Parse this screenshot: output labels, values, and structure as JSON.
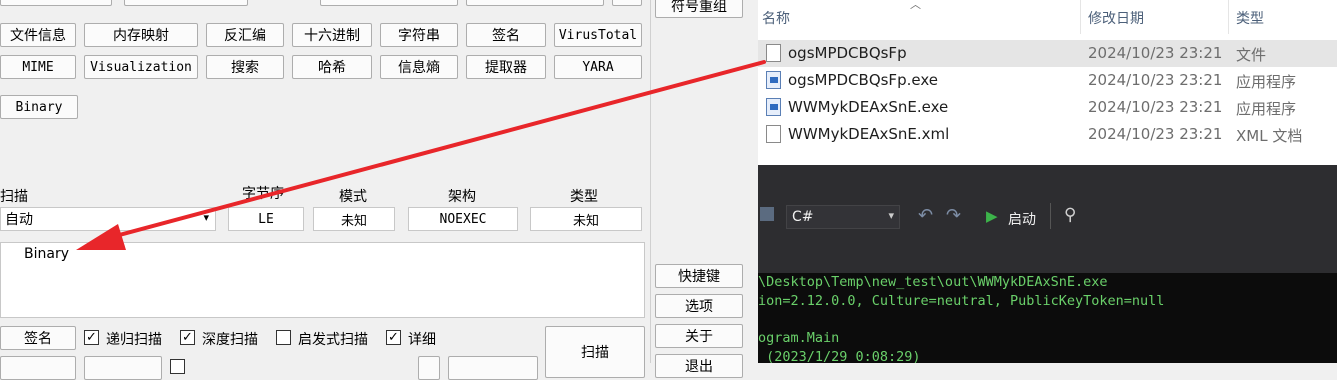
{
  "tool_panel": {
    "top_buttons": [
      "文件信息",
      "内存映射",
      "反汇编",
      "十六进制",
      "字符串",
      "签名",
      "VirusTotal"
    ],
    "second_buttons": [
      "MIME",
      "Visualization",
      "搜索",
      "哈希",
      "信息熵",
      "提取器",
      "YARA"
    ],
    "binary_button": "Binary",
    "right_buttons": [
      "符号重组",
      "快捷键",
      "选项",
      "关于",
      "退出"
    ],
    "scan_label": "扫描",
    "scan_value": "自动",
    "columns": {
      "endian": {
        "label": "字节序",
        "value": "LE"
      },
      "mode": {
        "label": "模式",
        "value": "未知"
      },
      "arch": {
        "label": "架构",
        "value": "NOEXEC"
      },
      "type": {
        "label": "类型",
        "value": "未知"
      }
    },
    "result_text": "Binary",
    "signature_button": "签名",
    "options": [
      {
        "label": "递归扫描",
        "checked": true
      },
      {
        "label": "深度扫描",
        "checked": true
      },
      {
        "label": "启发式扫描",
        "checked": false
      },
      {
        "label": "详细",
        "checked": true
      }
    ],
    "scan_button": "扫描"
  },
  "explorer": {
    "headers": {
      "name": "名称",
      "date": "修改日期",
      "type": "类型"
    },
    "files": [
      {
        "name": "ogsMPDCBQsFp",
        "date": "2024/10/23 23:21",
        "type": "文件",
        "icon": "file-icon"
      },
      {
        "name": "ogsMPDCBQsFp.exe",
        "date": "2024/10/23 23:21",
        "type": "应用程序",
        "icon": "exe-icon"
      },
      {
        "name": "WWMykDEAxSnE.exe",
        "date": "2024/10/23 23:21",
        "type": "应用程序",
        "icon": "exe-icon"
      },
      {
        "name": "WWMykDEAxSnE.xml",
        "date": "2024/10/23 23:21",
        "type": "XML 文档",
        "icon": "file-icon"
      }
    ]
  },
  "ide": {
    "language": "C#",
    "start_label": "启动",
    "console_lines": [
      "\\Desktop\\Temp\\new_test\\out\\WWMykDEAxSnE.exe",
      "ion=2.12.0.0, Culture=neutral, PublicKeyToken=null",
      "",
      "ogram.Main",
      " (2023/1/29 0:08:29)"
    ]
  },
  "colors": {
    "arrow": "#e8262a",
    "selected_row": "#e5e5e5",
    "console_text": "#6ad06a"
  }
}
